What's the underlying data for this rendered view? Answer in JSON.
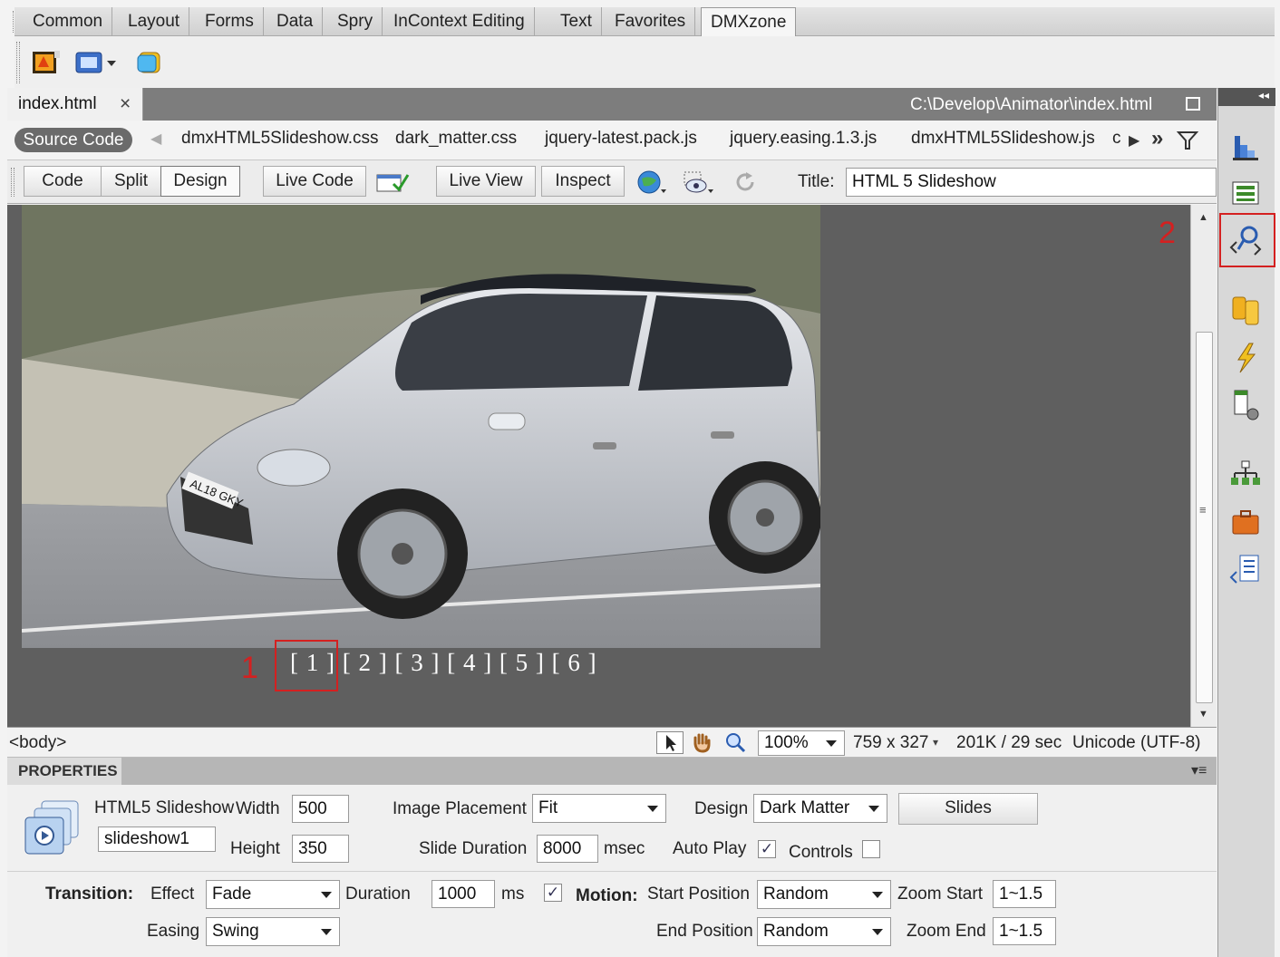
{
  "insert_bar": {
    "tabs": [
      "Common",
      "Layout",
      "Forms",
      "Data",
      "Spry",
      "InContext Editing",
      "Text",
      "Favorites",
      "DMXzone"
    ],
    "active_tab": "DMXzone",
    "icons": [
      "animator-icon",
      "slideshow-icon",
      "cube-icon"
    ]
  },
  "document": {
    "tab_label": "index.html",
    "close_glyph": "×",
    "path": "C:\\Develop\\Animator\\index.html"
  },
  "related_files": {
    "source_code_label": "Source Code",
    "files": [
      "dmxHTML5Slideshow.css",
      "dark_matter.css",
      "jquery-latest.pack.js",
      "jquery.easing.1.3.js",
      "dmxHTML5Slideshow.js"
    ],
    "overflow_glyph": "c"
  },
  "doc_toolbar": {
    "code": "Code",
    "split": "Split",
    "design": "Design",
    "live_code": "Live Code",
    "live_view": "Live View",
    "inspect": "Inspect",
    "title_label": "Title:",
    "title_value": "HTML 5 Slideshow"
  },
  "slideshow": {
    "pager": "[ 1 ] [ 2 ] [ 3 ] [ 4 ] [ 5 ] [ 6 ]",
    "plate": "AL18 GKY"
  },
  "annotations": {
    "marker_1": "1",
    "marker_2": "2"
  },
  "status_bar": {
    "tag": "<body>",
    "zoom": "100%",
    "size": "759 x 327",
    "download": "201K / 29 sec",
    "encoding": "Unicode (UTF-8)"
  },
  "properties": {
    "header": "PROPERTIES",
    "widget_name": "HTML5 Slideshow",
    "id_value": "slideshow1",
    "width_label": "Width",
    "width_value": "500",
    "height_label": "Height",
    "height_value": "350",
    "image_placement_label": "Image Placement",
    "image_placement_value": "Fit",
    "slide_duration_label": "Slide Duration",
    "slide_duration_value": "8000",
    "msec": "msec",
    "design_label": "Design",
    "design_value": "Dark Matter",
    "slides_button": "Slides",
    "auto_play_label": "Auto Play",
    "controls_label": "Controls",
    "transition_label": "Transition:",
    "effect_label": "Effect",
    "effect_value": "Fade",
    "duration_label": "Duration",
    "duration_value": "1000",
    "ms": "ms",
    "easing_label": "Easing",
    "easing_value": "Swing",
    "motion_label": "Motion:",
    "start_position_label": "Start Position",
    "start_position_value": "Random",
    "end_position_label": "End Position",
    "end_position_value": "Random",
    "zoom_start_label": "Zoom Start",
    "zoom_start_value": "1~1.5",
    "zoom_end_label": "Zoom End",
    "zoom_end_value": "1~1.5",
    "check_glyph": "✓"
  },
  "colors": {
    "annotation_red": "#d42020",
    "design_bg": "#5f5f5f",
    "panel_header": "#b6b6b6"
  }
}
